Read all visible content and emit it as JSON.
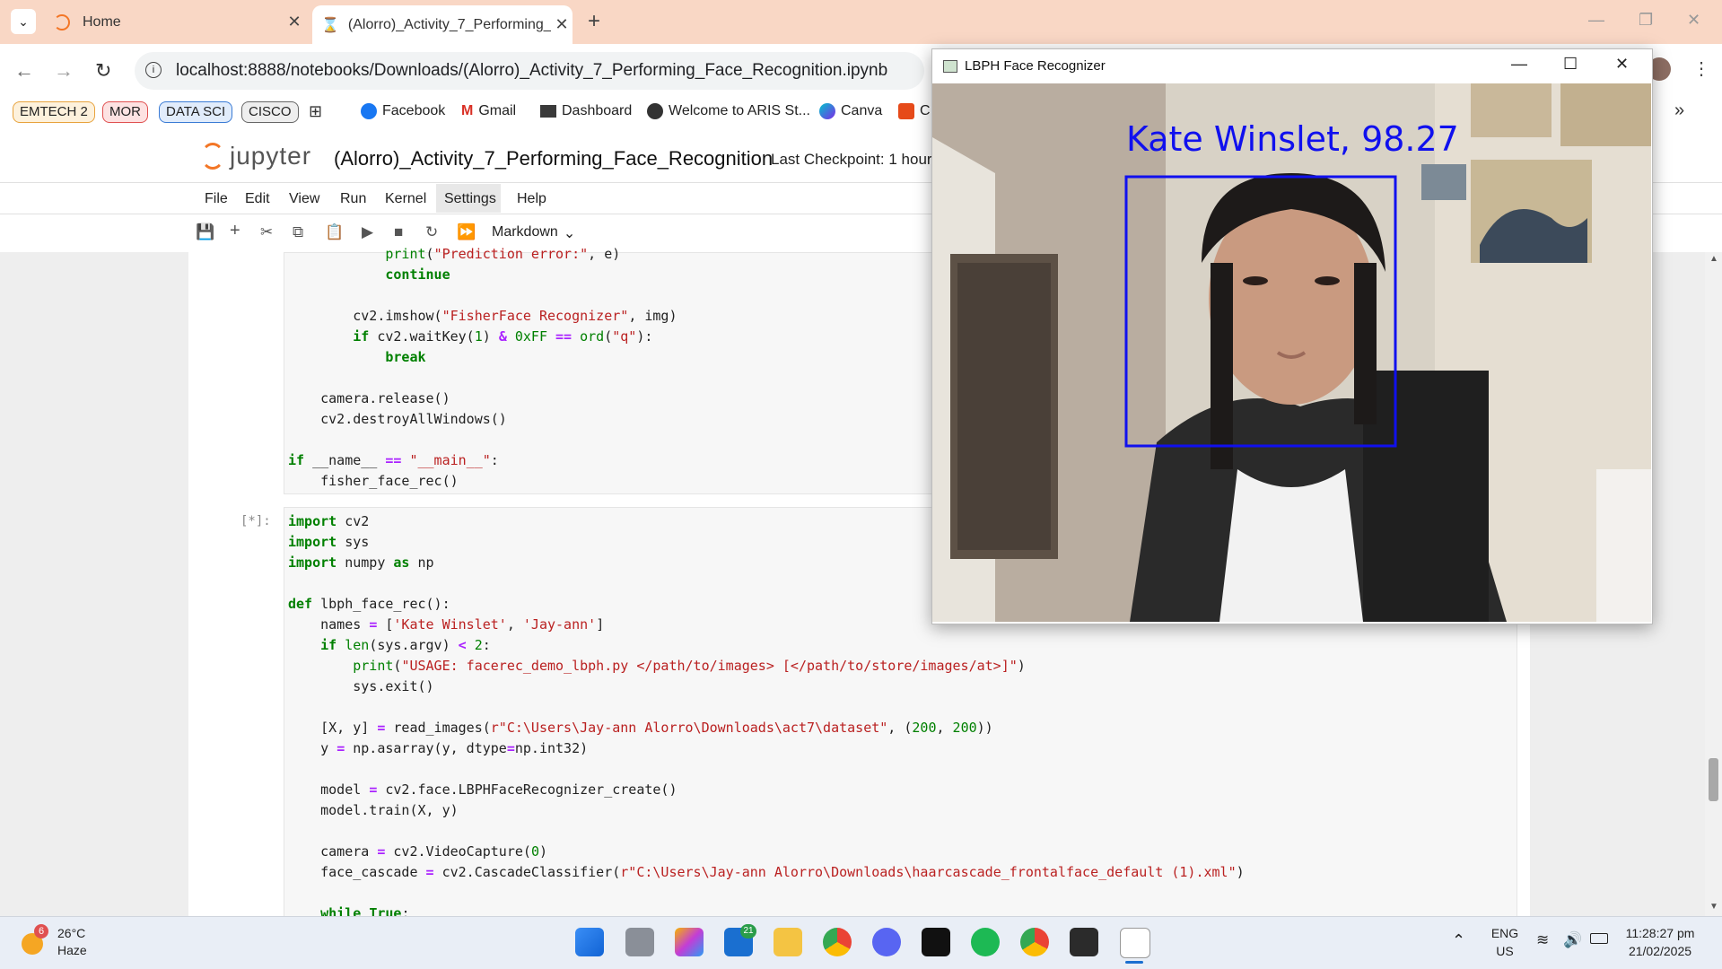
{
  "browser": {
    "tabs": [
      {
        "title": "Home",
        "active": false
      },
      {
        "title": "(Alorro)_Activity_7_Performing_",
        "active": true
      }
    ],
    "new_tab": "+",
    "url": "localhost:8888/notebooks/Downloads/(Alorro)_Activity_7_Performing_Face_Recognition.ipynb",
    "bookmarks_pills": [
      {
        "label": "EMTECH 2",
        "color": "#e8a33d"
      },
      {
        "label": "MOR",
        "color": "#e05050"
      },
      {
        "label": "DATA SCI",
        "color": "#3a7bd5"
      },
      {
        "label": "CISCO",
        "color": "#666666"
      }
    ],
    "bookmarks": [
      "Facebook",
      "Gmail",
      "Dashboard",
      "Welcome to ARIS St...",
      "Canva",
      "C"
    ],
    "overflow": "»"
  },
  "jupyter": {
    "logo": "jupyter",
    "notebook_title": "(Alorro)_Activity_7_Performing_Face_Recognition",
    "checkpoint": "Last Checkpoint: 1 hour",
    "menu": [
      "File",
      "Edit",
      "View",
      "Run",
      "Kernel",
      "Settings",
      "Help"
    ],
    "cell_type": "Markdown",
    "prompt": "[*]:"
  },
  "code_top": [
    "            print(\"Prediction error:\", e)",
    "            continue",
    "",
    "        cv2.imshow(\"FisherFace Recognizer\", img)",
    "        if cv2.waitKey(1) & 0xFF == ord(\"q\"):",
    "            break",
    "",
    "    camera.release()",
    "    cv2.destroyAllWindows()",
    "",
    "if __name__ == \"__main__\":",
    "    fisher_face_rec()"
  ],
  "code_cell": [
    "import cv2",
    "import sys",
    "import numpy as np",
    "",
    "def lbph_face_rec():",
    "    names = ['Kate Winslet', 'Jay-ann']",
    "    if len(sys.argv) < 2:",
    "        print(\"USAGE: facerec_demo_lbph.py </path/to/images> [</path/to/store/images/at>]\")",
    "        sys.exit()",
    "",
    "    [X, y] = read_images(r\"C:\\Users\\Jay-ann Alorro\\Downloads\\act7\\dataset\", (200, 200))",
    "    y = np.asarray(y, dtype=np.int32)",
    "",
    "    model = cv2.face.LBPHFaceRecognizer_create()",
    "    model.train(X, y)",
    "",
    "    camera = cv2.VideoCapture(0)",
    "    face_cascade = cv2.CascadeClassifier(r\"C:\\Users\\Jay-ann Alorro\\Downloads\\haarcascade_frontalface_default (1).xml\")",
    "",
    "    while True:"
  ],
  "lbph_window": {
    "title": "LBPH Face Recognizer",
    "overlay_label": "Kate Winslet, 98.27"
  },
  "taskbar": {
    "weather_badge": "6",
    "temperature": "26°C",
    "condition": "Haze",
    "teams_badge": "21",
    "lang_top": "ENG",
    "lang_bottom": "US",
    "time": "11:28:27 pm",
    "date": "21/02/2025"
  }
}
